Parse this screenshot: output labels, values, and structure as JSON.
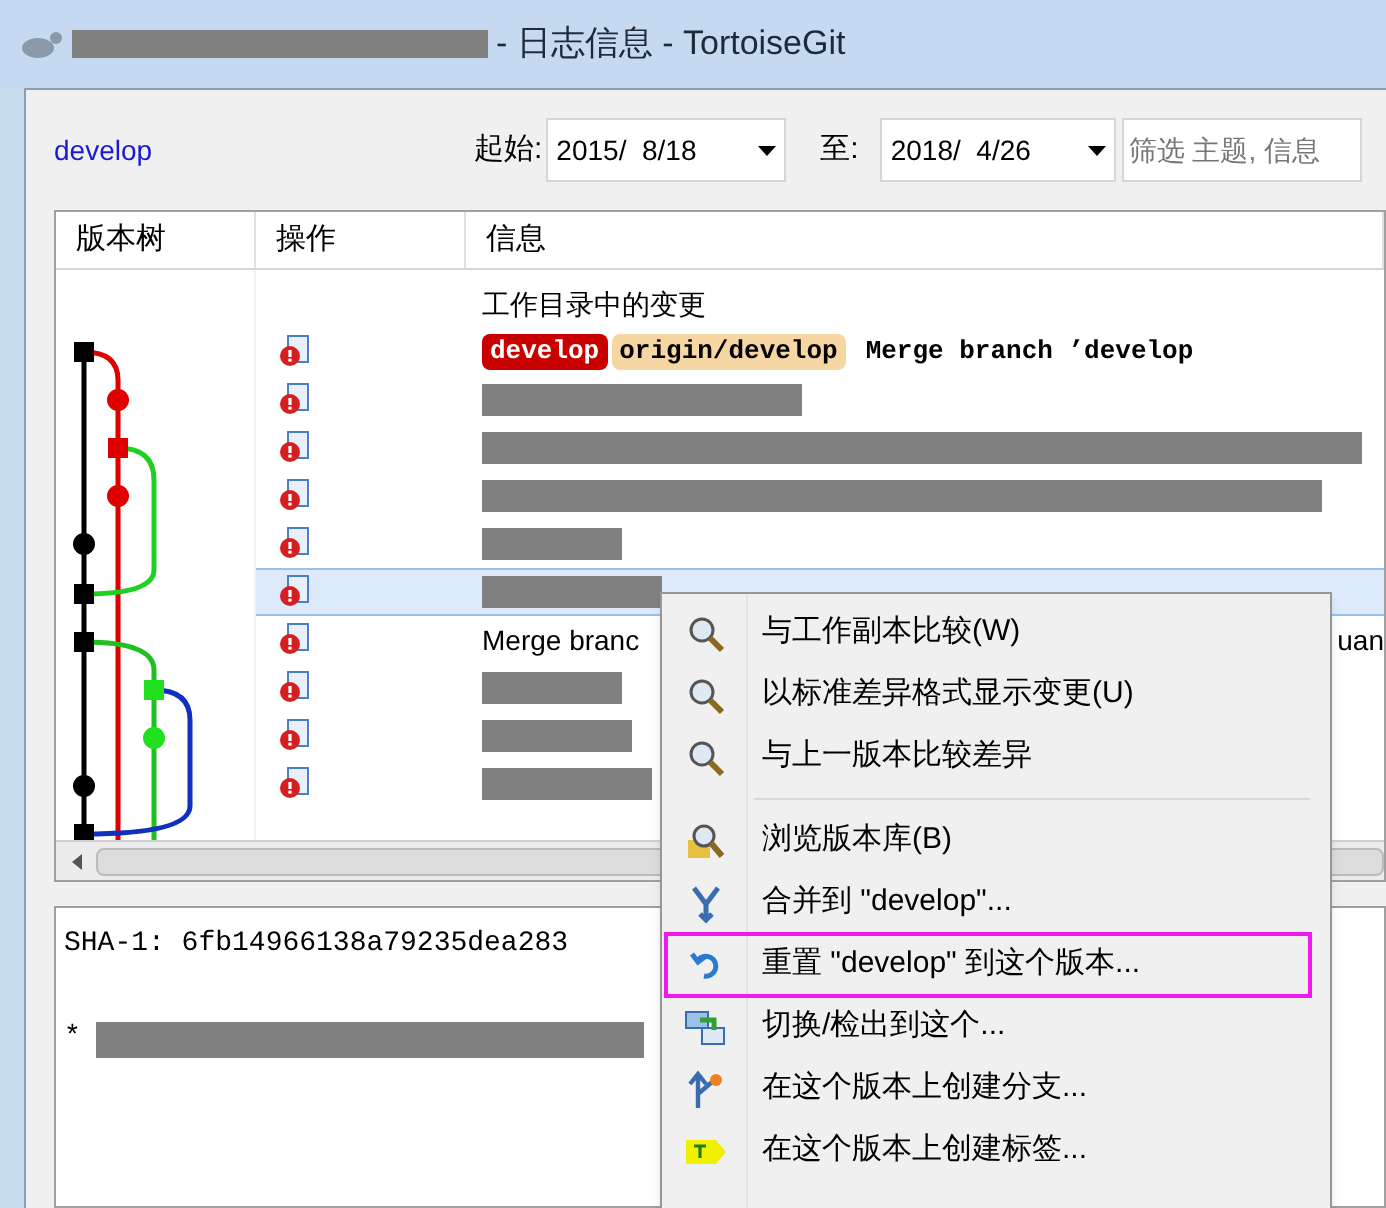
{
  "window": {
    "title": "- 日志信息 - TortoiseGit"
  },
  "branch": "develop",
  "date_from": {
    "label": "起始:",
    "value": "2015/  8/18"
  },
  "date_to": {
    "label": "至:",
    "value": "2018/  4/26"
  },
  "filter": {
    "placeholder": "筛选 主题, 信息"
  },
  "columns": [
    "版本树",
    "操作",
    "信息"
  ],
  "rows": [
    {
      "kind": "text",
      "message": "工作目录中的变更",
      "selected": false
    },
    {
      "kind": "refs",
      "refs": [
        {
          "label": "develop",
          "kind": "local"
        },
        {
          "label": "origin/develop",
          "kind": "remote"
        }
      ],
      "message": "Merge branch ’develop",
      "selected": false
    },
    {
      "kind": "redacted",
      "selected": false
    },
    {
      "kind": "redacted",
      "selected": false
    },
    {
      "kind": "redacted",
      "selected": false
    },
    {
      "kind": "redacted",
      "selected": false
    },
    {
      "kind": "redacted",
      "selected": true
    },
    {
      "kind": "split",
      "message": "Merge branc",
      "tail": "uan",
      "selected": false
    },
    {
      "kind": "redacted",
      "selected": false
    },
    {
      "kind": "redacted",
      "selected": false
    },
    {
      "kind": "redacted",
      "selected": false
    }
  ],
  "details": {
    "sha": "SHA-1: 6fb14966138a79235dea283",
    "bullet": "*"
  },
  "menu": [
    {
      "kind": "item",
      "label": "与工作副本比较(W)",
      "highlighted": false
    },
    {
      "kind": "item",
      "label": "以标准差异格式显示变更(U)",
      "highlighted": false
    },
    {
      "kind": "item",
      "label": "与上一版本比较差异",
      "highlighted": false
    },
    {
      "kind": "separator"
    },
    {
      "kind": "item",
      "label": "浏览版本库(B)",
      "highlighted": false
    },
    {
      "kind": "item",
      "label": "合并到 \"develop\"...",
      "highlighted": false
    },
    {
      "kind": "item",
      "label": "重置 \"develop\" 到这个版本...",
      "highlighted": true
    },
    {
      "kind": "item",
      "label": "切换/检出到这个...",
      "highlighted": false
    },
    {
      "kind": "item",
      "label": "在这个版本上创建分支...",
      "highlighted": false
    },
    {
      "kind": "item",
      "label": "在这个版本上创建标签...",
      "highlighted": false
    }
  ]
}
